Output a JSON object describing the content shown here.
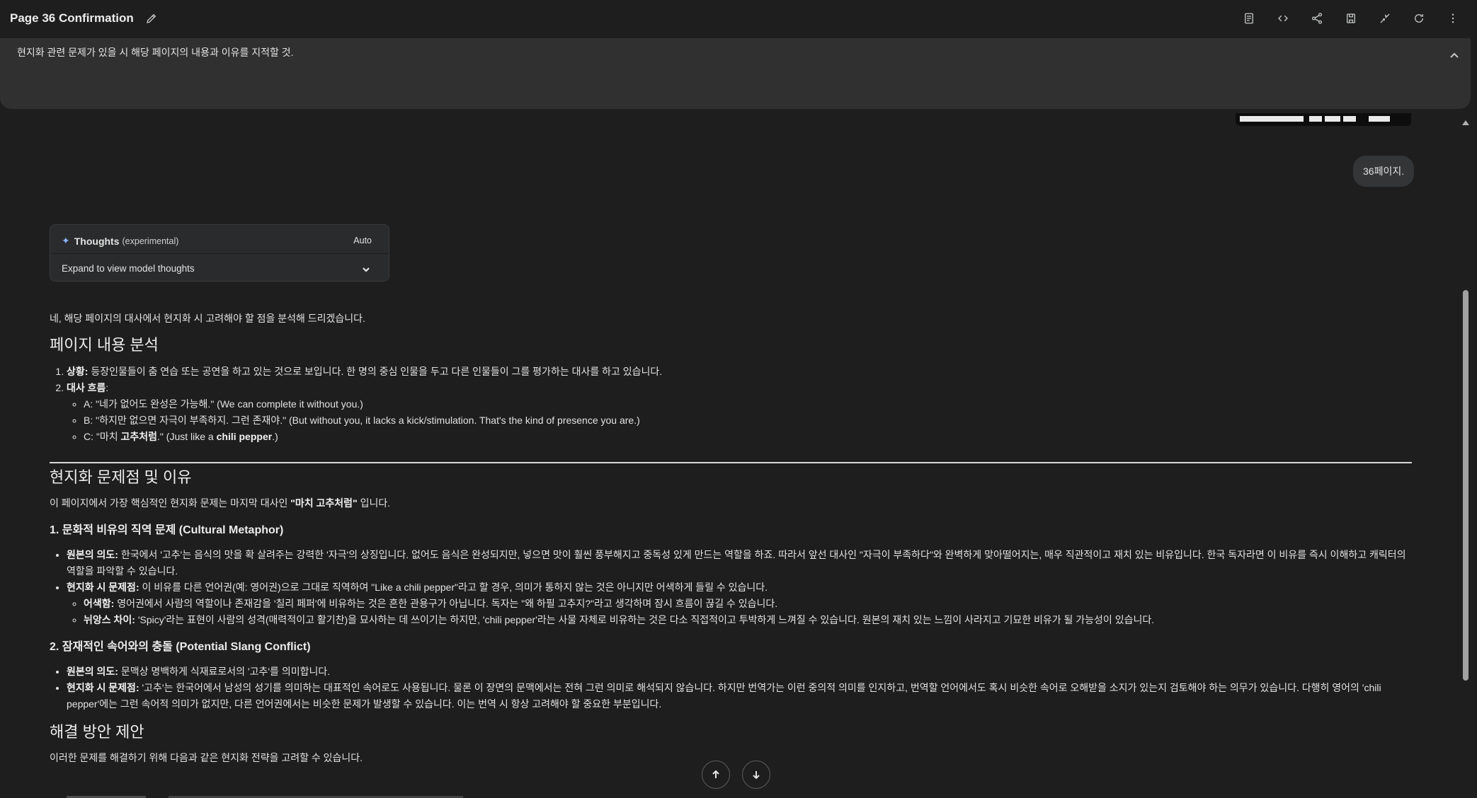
{
  "header": {
    "title": "Page 36 Confirmation",
    "icons": [
      "edit-icon",
      "notes-icon",
      "code-icon",
      "share-icon",
      "save-icon",
      "compare-icon",
      "refresh-icon",
      "more-icon"
    ]
  },
  "instructions": {
    "text": "현지화 관련 문제가 있을 시 해당 페이지의 내용과 이유를 지적할 것."
  },
  "user_message": "36페이지.",
  "thoughts": {
    "title": "Thoughts",
    "tag": "(experimental)",
    "mode": "Auto",
    "expand_label": "Expand to view model thoughts"
  },
  "response": {
    "intro": "네, 해당 페이지의 대사에서 현지화 시 고려해야 할 점을 분석해 드리겠습니다.",
    "section1_title": "페이지 내용 분석",
    "s1_item1_label": "상황:",
    "s1_item1_text": " 등장인물들이 춤 연습 또는 공연을 하고 있는 것으로 보입니다. 한 명의 중심 인물을 두고 다른 인물들이 그를 평가하는 대사를 하고 있습니다.",
    "s1_item2_label": "대사 흐름",
    "s1_item2_colon": ":",
    "dialogue_a": "A: \"네가 없어도 완성은 가능해.\" (We can complete it without you.)",
    "dialogue_b": "B: \"하지만 없으면 자극이 부족하지. 그런 존재야.\" (But without you, it lacks a kick/stimulation. That's the kind of presence you are.)",
    "dialogue_c_pre": "C: \"마치 ",
    "dialogue_c_bold": "고추처럼",
    "dialogue_c_mid": ".\" (Just like a ",
    "dialogue_c_bold2": "chili pepper",
    "dialogue_c_post": ".)",
    "section2_title": "현지화 문제점 및 이유",
    "s2_intro_pre": "이 페이지에서 가장 핵심적인 현지화 문제는 마지막 대사인 ",
    "s2_intro_bold": "\"마치 고추처럼\"",
    "s2_intro_post": " 입니다.",
    "sub1_title": "1. 문화적 비유의 직역 문제 (Cultural Metaphor)",
    "sub1_b1_label": "원본의 의도:",
    "sub1_b1_text": " 한국에서 '고추'는 음식의 맛을 확 살려주는 강력한 '자극'의 상징입니다. 없어도 음식은 완성되지만, 넣으면 맛이 훨씬 풍부해지고 중독성 있게 만드는 역할을 하죠. 따라서 앞선 대사인 \"자극이 부족하다\"와 완벽하게 맞아떨어지는, 매우 직관적이고 재치 있는 비유입니다. 한국 독자라면 이 비유를 즉시 이해하고 캐릭터의 역할을 파악할 수 있습니다.",
    "sub1_b2_label": "현지화 시 문제점:",
    "sub1_b2_text": " 이 비유를 다른 언어권(예: 영어권)으로 그대로 직역하여 \"Like a chili pepper\"라고 할 경우, 의미가 통하지 않는 것은 아니지만 어색하게 들릴 수 있습니다.",
    "sub1_c1_label": "어색함:",
    "sub1_c1_text": " 영어권에서 사람의 역할이나 존재감을 '칠리 페퍼'에 비유하는 것은 흔한 관용구가 아닙니다. 독자는 \"왜 하필 고추지?\"라고 생각하며 잠시 흐름이 끊길 수 있습니다.",
    "sub1_c2_label": "뉘앙스 차이:",
    "sub1_c2_text": " 'Spicy'라는 표현이 사람의 성격(매력적이고 활기찬)을 묘사하는 데 쓰이기는 하지만, 'chili pepper'라는 사물 자체로 비유하는 것은 다소 직접적이고 투박하게 느껴질 수 있습니다. 원본의 재치 있는 느낌이 사라지고 기묘한 비유가 될 가능성이 있습니다.",
    "sub2_title": "2. 잠재적인 속어와의 충돌 (Potential Slang Conflict)",
    "sub2_b1_label": "원본의 의도:",
    "sub2_b1_text": " 문맥상 명백하게 식재료로서의 '고추'를 의미합니다.",
    "sub2_b2_label": "현지화 시 문제점:",
    "sub2_b2_text": " '고추'는 한국어에서 남성의 성기를 의미하는 대표적인 속어로도 사용됩니다. 물론 이 장면의 문맥에서는 전혀 그런 의미로 해석되지 않습니다. 하지만 번역가는 이런 중의적 의미를 인지하고, 번역할 언어에서도 혹시 비슷한 속어로 오해받을 소지가 있는지 검토해야 하는 의무가 있습니다. 다행히 영어의 'chili pepper'에는 그런 속어적 의미가 없지만, 다른 언어권에서는 비슷한 문제가 발생할 수 있습니다. 이는 번역 시 항상 고려해야 할 중요한 부분입니다.",
    "section3_title": "해결 방안 제안",
    "s3_intro": "이러한 문제를 해결하기 위해 다음과 같은 현지화 전략을 고려할 수 있습니다."
  }
}
